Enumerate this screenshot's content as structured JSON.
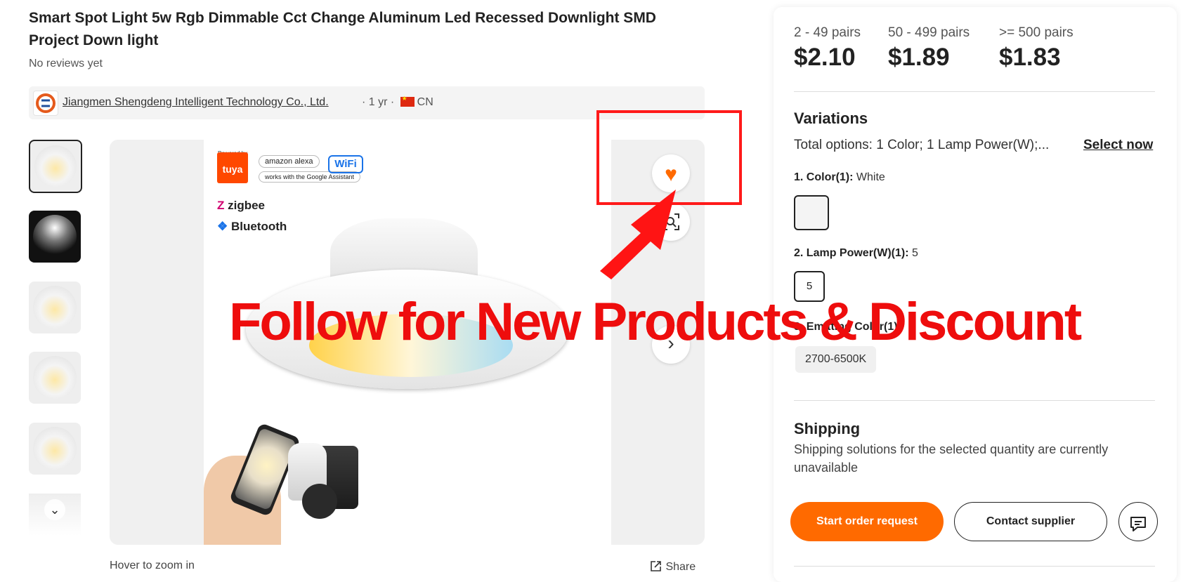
{
  "product": {
    "title": "Smart Spot Light 5w Rgb Dimmable Cct Change Aluminum Led Recessed Downlight SMD Project Down light",
    "reviews": "No reviews yet"
  },
  "supplier": {
    "name": "Jiangmen Shengdeng Intelligent Technology Co., Ltd.",
    "meta_years": "· 1 yr ·",
    "country": "CN"
  },
  "gallery": {
    "thumbnails": [
      "thumbnail-1",
      "thumbnail-2",
      "thumbnail-3",
      "thumbnail-4",
      "thumbnail-5",
      "thumbnail-6"
    ],
    "image_badges": {
      "tuya_powered": "Powered by",
      "tuya": "tuya",
      "alexa": "amazon alexa",
      "google": "works with the Google Assistant",
      "wifi": "WiFi",
      "zigbee": "zigbee",
      "bluetooth": "Bluetooth"
    },
    "hover_hint": "Hover to zoom in",
    "share_label": "Share",
    "favorite_icon": "heart-icon",
    "zoom_icon": "image-search-icon",
    "next_icon": "chevron-right-icon"
  },
  "annotation": {
    "text": "Follow for New Products & Discount",
    "color": "#ee0d0d"
  },
  "pricing": {
    "tiers": [
      {
        "qty": "2 - 49 pairs",
        "price": "$2.10"
      },
      {
        "qty": "50 - 499 pairs",
        "price": "$1.89"
      },
      {
        "qty": ">= 500 pairs",
        "price": "$1.83"
      }
    ]
  },
  "variations": {
    "title": "Variations",
    "summary": "Total options: 1 Color; 1 Lamp Power(W);...",
    "select_now": "Select now",
    "color_label": "1. Color(1):",
    "color_value": "White",
    "power_label": "2. Lamp Power(W)(1):",
    "power_value": "5",
    "power_option": "5",
    "cct_label": "3. Emitting Color(1):",
    "cct_option": "2700-6500K"
  },
  "shipping": {
    "title": "Shipping",
    "text": "Shipping solutions for the selected quantity are currently unavailable"
  },
  "actions": {
    "start_order": "Start order request",
    "contact_supplier": "Contact supplier",
    "chat_icon": "chat-icon"
  },
  "colors": {
    "accent": "#ff6a00",
    "annotation_red": "#ee0d0d"
  }
}
